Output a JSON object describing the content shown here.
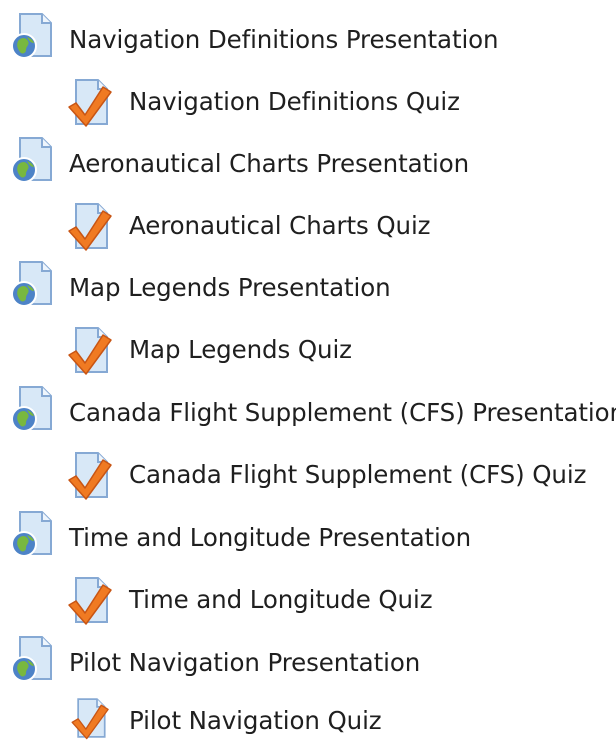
{
  "activities": [
    {
      "type": "presentation",
      "icon": "web-page-icon",
      "label": "Navigation Definitions Presentation"
    },
    {
      "type": "quiz",
      "icon": "quiz-checkmark-icon",
      "label": "Navigation Definitions Quiz"
    },
    {
      "type": "presentation",
      "icon": "web-page-icon",
      "label": "Aeronautical Charts Presentation"
    },
    {
      "type": "quiz",
      "icon": "quiz-checkmark-icon",
      "label": "Aeronautical Charts Quiz"
    },
    {
      "type": "presentation",
      "icon": "web-page-icon",
      "label": "Map Legends Presentation"
    },
    {
      "type": "quiz",
      "icon": "quiz-checkmark-icon",
      "label": "Map Legends Quiz"
    },
    {
      "type": "presentation",
      "icon": "web-page-icon",
      "label": "Canada Flight Supplement (CFS) Presentation"
    },
    {
      "type": "quiz",
      "icon": "quiz-checkmark-icon",
      "label": "Canada Flight Supplement (CFS) Quiz"
    },
    {
      "type": "presentation",
      "icon": "web-page-icon",
      "label": "Time and Longitude Presentation"
    },
    {
      "type": "quiz",
      "icon": "quiz-checkmark-icon",
      "label": "Time and Longitude Quiz"
    },
    {
      "type": "presentation",
      "icon": "web-page-icon",
      "label": "Pilot Navigation Presentation"
    },
    {
      "type": "quiz",
      "icon": "quiz-checkmark-icon",
      "label": "Pilot Navigation Quiz"
    }
  ],
  "colors": {
    "text": "#1f1f1f",
    "page_fill": "#d8e8f7",
    "page_stroke": "#86a9d4",
    "globe_blue": "#4d83c7",
    "globe_green": "#78b83f",
    "check_orange": "#f07a22"
  }
}
